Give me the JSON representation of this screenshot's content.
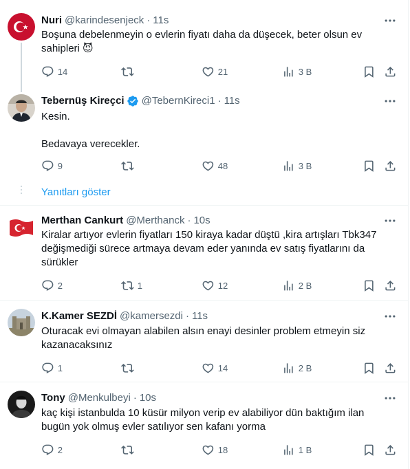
{
  "tweets": [
    {
      "name": "Nuri",
      "handle": "@karindesenjeck",
      "time": "11s",
      "lines": [
        "Boşuna debelenmeyin o evlerin fiyatı daha da düşecek, beter olsun ev",
        "sahipleri 😈"
      ],
      "replies": "14",
      "retweets": "",
      "likes": "21",
      "views": "3 B"
    },
    {
      "name": "Tebernüş Kireçci",
      "handle": "@TebernKireci1",
      "time": "11s",
      "lines": [
        "Kesin.",
        "",
        "Bedavaya verecekler."
      ],
      "replies": "9",
      "retweets": "",
      "likes": "48",
      "views": "3 B"
    },
    {
      "name": "Merthan Cankurt",
      "handle": "@Merthanck",
      "time": "10s",
      "lines": [
        "Kiralar artıyor evlerin fiyatları 150 kiraya kadar düştü ,kira artışları Tbk347",
        "değişmediği sürece artmaya devam eder yanında ev satış fiyatlarını da",
        "sürükler"
      ],
      "replies": "2",
      "retweets": "1",
      "likes": "12",
      "views": "2 B"
    },
    {
      "name": "K.Kamer SEZDİ",
      "handle": "@kamersezdi",
      "time": "11s",
      "lines": [
        "Oturacak evi olmayan alabilen alsın enayi desinler problem etmeyin siz",
        "kazanacaksınız"
      ],
      "replies": "1",
      "retweets": "",
      "likes": "14",
      "views": "2 B"
    },
    {
      "name": "Tony",
      "handle": "@Menkulbeyi",
      "time": "10s",
      "lines": [
        "kaç kişi istanbulda 10 küsür milyon verip ev alabiliyor dün baktığım ilan",
        "bugün yok olmuş evler satılıyor sen kafanı yorma"
      ],
      "replies": "2",
      "retweets": "",
      "likes": "18",
      "views": "1 B"
    }
  ],
  "show_replies_label": "Yanıtları göster",
  "colors": {
    "accent": "#1d9bf0",
    "muted": "#536471",
    "text": "#0f1419",
    "separator": "#eff3f4"
  },
  "icons": [
    "reply-icon",
    "retweet-icon",
    "like-icon",
    "views-icon",
    "bookmark-icon",
    "share-icon",
    "more-icon",
    "verified-badge-icon"
  ]
}
